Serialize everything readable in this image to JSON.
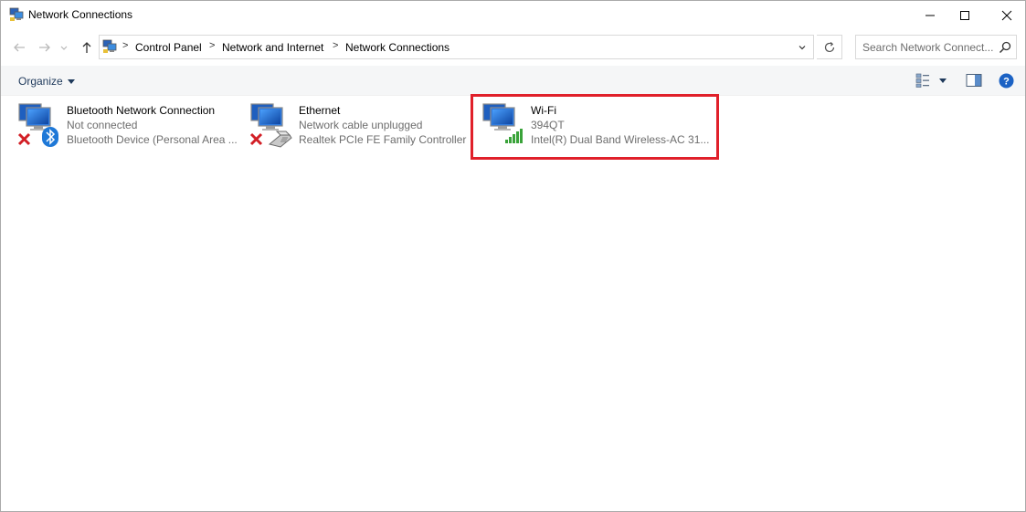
{
  "window": {
    "title": "Network Connections"
  },
  "address_bar": {
    "breadcrumbs": [
      "Control Panel",
      "Network and Internet",
      "Network Connections"
    ],
    "separator": ">"
  },
  "search": {
    "placeholder": "Search Network Connect..."
  },
  "command_bar": {
    "organize_label": "Organize"
  },
  "connections": [
    {
      "name": "Bluetooth Network Connection",
      "status": "Not connected",
      "device": "Bluetooth Device (Personal Area ...",
      "icon": "bluetooth-network-icon",
      "state": "disconnected"
    },
    {
      "name": "Ethernet",
      "status": "Network cable unplugged",
      "device": "Realtek PCIe FE Family Controller",
      "icon": "ethernet-network-icon",
      "state": "disconnected"
    },
    {
      "name": "Wi-Fi",
      "status": "394QT",
      "device": "Intel(R) Dual Band Wireless-AC 31...",
      "icon": "wifi-network-icon",
      "state": "connected",
      "highlighted": true
    }
  ],
  "colors": {
    "highlight": "#e0202a",
    "signal": "#3aa33a",
    "disconnected_x": "#d21f26",
    "bluetooth": "#1e78d7"
  }
}
